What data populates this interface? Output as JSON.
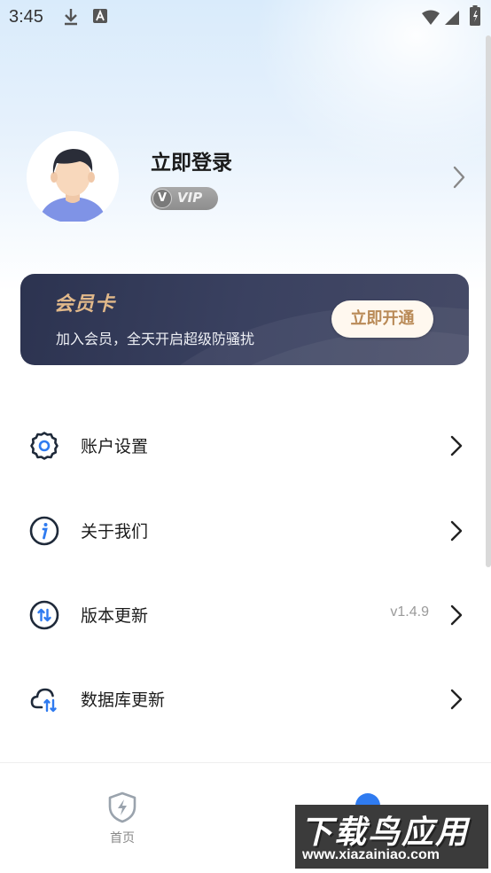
{
  "status_bar": {
    "time": "3:45"
  },
  "profile": {
    "login_label": "立即登录",
    "vip_label": "VIP"
  },
  "vip_card": {
    "title": "会员卡",
    "description": "加入会员，全天开启超级防骚扰",
    "button_label": "立即开通"
  },
  "menu": {
    "items": [
      {
        "label": "账户设置",
        "icon": "gear-icon"
      },
      {
        "label": "关于我们",
        "icon": "info-icon"
      },
      {
        "label": "版本更新",
        "icon": "update-icon",
        "value": "v1.4.9"
      },
      {
        "label": "数据库更新",
        "icon": "cloud-sync-icon"
      }
    ]
  },
  "bottom_nav": {
    "home_label": "首页"
  },
  "watermark": {
    "title": "下载鸟应用",
    "url": "www.xiazainiao.com"
  },
  "colors": {
    "accent": "#2f7bf0",
    "card_bg": "#2c3350",
    "card_title": "#e2b98a"
  }
}
